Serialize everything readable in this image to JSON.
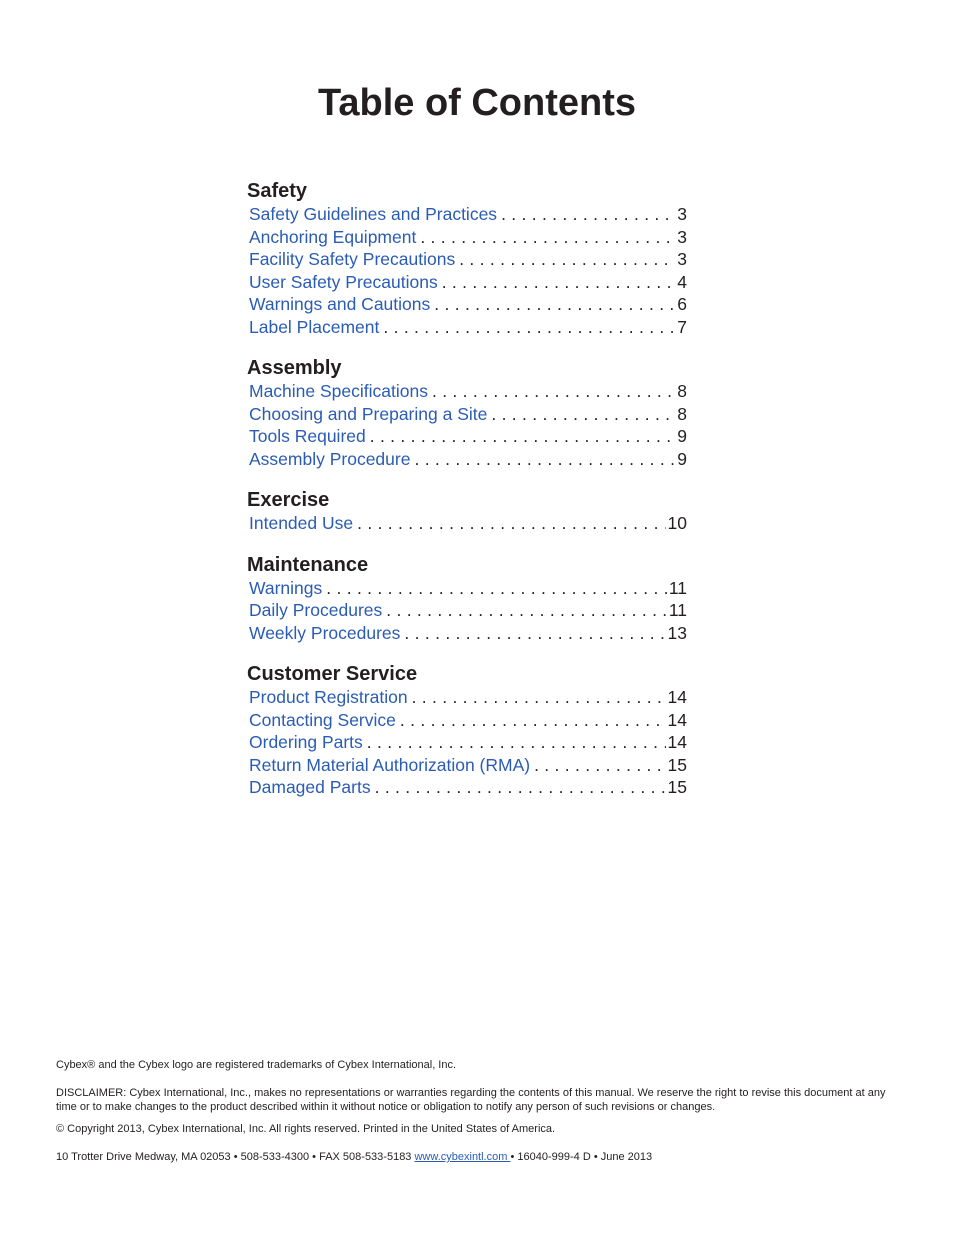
{
  "title": "Table of Contents",
  "sections": [
    {
      "heading": "Safety",
      "entries": [
        {
          "label": "Safety Guidelines and Practices",
          "page": "3"
        },
        {
          "label": "Anchoring Equipment",
          "page": "3"
        },
        {
          "label": "Facility Safety Precautions",
          "page": "3"
        },
        {
          "label": "User Safety Precautions",
          "page": "4"
        },
        {
          "label": "Warnings and Cautions",
          "page": "6"
        },
        {
          "label": "Label Placement",
          "page": "7"
        }
      ]
    },
    {
      "heading": "Assembly",
      "entries": [
        {
          "label": "Machine Specifications",
          "page": "8"
        },
        {
          "label": "Choosing and Preparing a Site",
          "page": "8"
        },
        {
          "label": "Tools Required",
          "page": "9"
        },
        {
          "label": "Assembly Procedure",
          "page": "9"
        }
      ]
    },
    {
      "heading": "Exercise",
      "entries": [
        {
          "label": "Intended Use",
          "page": "10"
        }
      ]
    },
    {
      "heading": "Maintenance",
      "entries": [
        {
          "label": "Warnings",
          "page": "11"
        },
        {
          "label": "Daily Procedures",
          "page": "11"
        },
        {
          "label": "Weekly Procedures",
          "page": "13"
        }
      ]
    },
    {
      "heading": "Customer Service",
      "entries": [
        {
          "label": "Product Registration",
          "page": "14"
        },
        {
          "label": "Contacting Service",
          "page": "14"
        },
        {
          "label": "Ordering Parts",
          "page": "14"
        },
        {
          "label": "Return Material Authorization (RMA)",
          "page": "15"
        },
        {
          "label": "Damaged Parts",
          "page": "15"
        }
      ]
    }
  ],
  "footer": {
    "trademark": "Cybex® and the Cybex logo are registered trademarks of Cybex International, Inc.",
    "disclaimer": "DISCLAIMER: Cybex International, Inc., makes no representations or warranties regarding the contents of this manual. We reserve the right to revise this document at any time or to make changes to the product described within it without notice or obligation to notify any person of such revisions or changes.",
    "copyright": "© Copyright 2013, Cybex International, Inc. All rights reserved. Printed in the United States of America.",
    "address_prefix": "10 Trotter Drive Medway, MA 02053 • 508-533-4300 • FAX 508-533-5183 ",
    "website": "www.cybexintl.com ",
    "address_suffix": "• 16040-999-4 D • June 2013"
  },
  "colors": {
    "link": "#2b5cb4",
    "text": "#231f20"
  }
}
